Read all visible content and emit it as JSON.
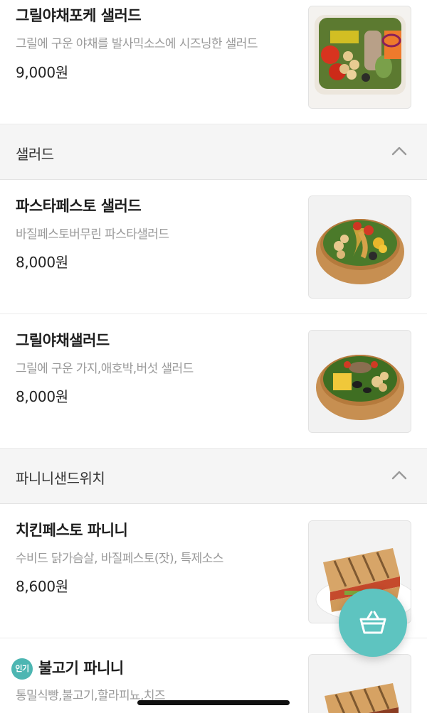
{
  "colors": {
    "accent": "#5ec4c0",
    "badge": "#4db6b2",
    "section_bg": "#f5f5f5",
    "desc_text": "#9a9a9a"
  },
  "items_top": [
    {
      "name": "그릴야채포케 샐러드",
      "desc": "그릴에 구운 야채를 발사믹소스에 시즈닝한 샐러드",
      "price": "9,000원",
      "image": "poke-salad-bowl-image"
    }
  ],
  "sections": [
    {
      "title": "샐러드",
      "chevron": "chevron-up-icon",
      "items": [
        {
          "name": "파스타페스토 샐러드",
          "desc": "바질페스토버무린 파스타샐러드",
          "price": "8,000원",
          "image": "pasta-salad-image"
        },
        {
          "name": "그릴야채샐러드",
          "desc": "그릴에 구운 가지,애호박,버섯 샐러드",
          "price": "8,000원",
          "image": "grilled-veg-salad-image"
        }
      ]
    },
    {
      "title": "파니니샌드위치",
      "chevron": "chevron-up-icon",
      "items": [
        {
          "name": "치킨페스토 파니니",
          "desc": "수비드 닭가슴살, 바질페스토(잣), 특제소스",
          "price": "8,600원",
          "image": "chicken-panini-image"
        },
        {
          "name": "불고기 파니니",
          "badge": "인기",
          "desc": "통밀식빵,불고기,할라피뇨,치즈",
          "price": "",
          "image": "bulgogi-panini-image"
        }
      ]
    }
  ],
  "cart_button": {
    "icon": "basket-icon"
  }
}
